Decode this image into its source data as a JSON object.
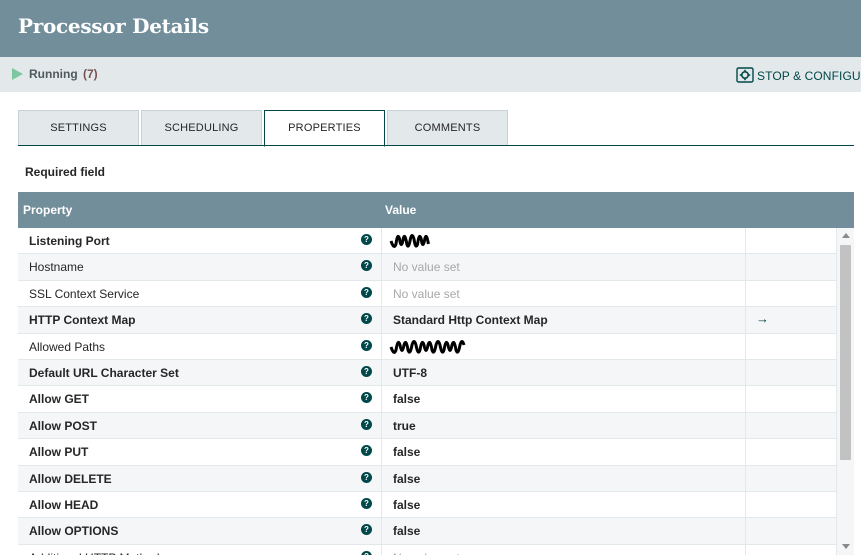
{
  "dialog": {
    "title": "Processor Details"
  },
  "status": {
    "state_label": "Running",
    "count_label": "(7)",
    "stop_configure_label": "STOP & CONFIGURE",
    "running_color": "#7dc7a0"
  },
  "tabs": [
    {
      "label": "SETTINGS",
      "active": false
    },
    {
      "label": "SCHEDULING",
      "active": false
    },
    {
      "label": "PROPERTIES",
      "active": true
    },
    {
      "label": "COMMENTS",
      "active": false
    }
  ],
  "required_field_label": "Required field",
  "grid": {
    "header": {
      "property": "Property",
      "value": "Value"
    },
    "rows": [
      {
        "name": "Listening Port",
        "required": true,
        "value": "",
        "value_state": "redacted",
        "help_icon": "question-circle-icon"
      },
      {
        "name": "Hostname",
        "required": false,
        "value": "No value set",
        "value_state": "unset",
        "help_icon": "question-circle-icon"
      },
      {
        "name": "SSL Context Service",
        "required": false,
        "value": "No value set",
        "value_state": "unset",
        "help_icon": "question-circle-icon"
      },
      {
        "name": "HTTP Context Map",
        "required": true,
        "value": "Standard Http Context Map",
        "value_state": "set",
        "help_icon": "question-circle-icon",
        "action_icon": "arrow-right-icon"
      },
      {
        "name": "Allowed Paths",
        "required": false,
        "value": "",
        "value_state": "redacted",
        "help_icon": "question-circle-icon"
      },
      {
        "name": "Default URL Character Set",
        "required": true,
        "value": "UTF-8",
        "value_state": "set",
        "help_icon": "question-circle-icon"
      },
      {
        "name": "Allow GET",
        "required": true,
        "value": "false",
        "value_state": "set",
        "help_icon": "question-circle-icon"
      },
      {
        "name": "Allow POST",
        "required": true,
        "value": "true",
        "value_state": "set",
        "help_icon": "question-circle-icon"
      },
      {
        "name": "Allow PUT",
        "required": true,
        "value": "false",
        "value_state": "set",
        "help_icon": "question-circle-icon"
      },
      {
        "name": "Allow DELETE",
        "required": true,
        "value": "false",
        "value_state": "set",
        "help_icon": "question-circle-icon"
      },
      {
        "name": "Allow HEAD",
        "required": true,
        "value": "false",
        "value_state": "set",
        "help_icon": "question-circle-icon"
      },
      {
        "name": "Allow OPTIONS",
        "required": true,
        "value": "false",
        "value_state": "set",
        "help_icon": "question-circle-icon"
      },
      {
        "name": "Additional HTTP Methods",
        "required": false,
        "value": "No value set",
        "value_state": "unset",
        "help_icon": "question-circle-icon"
      }
    ]
  },
  "colors": {
    "header_bg": "#728e9b",
    "accent": "#004849",
    "status_bg": "#e3e8eb"
  }
}
